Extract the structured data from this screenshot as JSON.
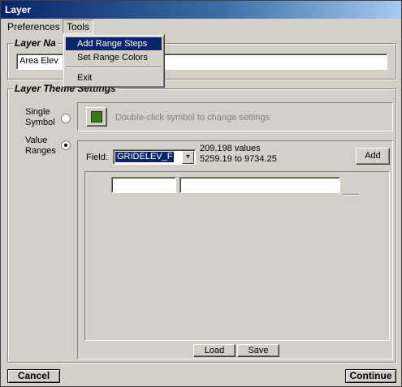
{
  "window": {
    "title": "Layer"
  },
  "menubar": {
    "preferences": "Preferences",
    "tools": "Tools"
  },
  "tools_menu": {
    "items": [
      "Add Range Steps",
      "Set Range Colors",
      "Exit"
    ]
  },
  "layer_name": {
    "legend": "Layer Na",
    "value": "Area Elev"
  },
  "theme": {
    "legend": "Layer Theme Settings",
    "single_symbol_label_1": "Single",
    "single_symbol_label_2": "Symbol",
    "symbol_hint": "Double-click symbol to change settings",
    "symbol_color": "#3a7a1a",
    "value_ranges_label_1": "Value",
    "value_ranges_label_2": "Ranges",
    "selected_mode": "value_ranges"
  },
  "field": {
    "label": "Field:",
    "selected": "GRIDELEV_F",
    "stats_count": "209,198 values",
    "stats_range": "5259.19 to 9734.25",
    "add_label": "Add"
  },
  "range_row": {
    "from": "",
    "to": ""
  },
  "buttons": {
    "load": "Load",
    "save": "Save",
    "cancel": "Cancel",
    "continue": "Continue"
  }
}
